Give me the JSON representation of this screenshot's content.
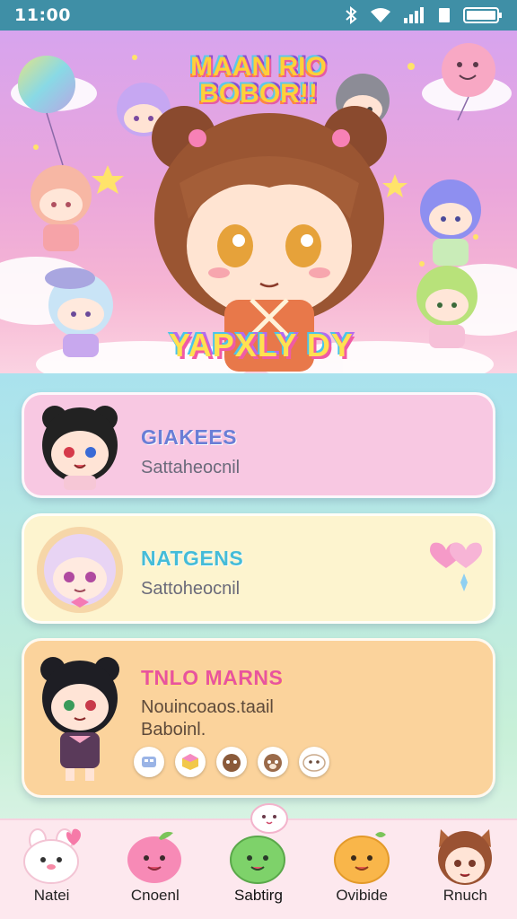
{
  "status_bar": {
    "time": "11:00",
    "icons": [
      "bluetooth-icon",
      "wifi-icon",
      "signal-icon",
      "battery-icon"
    ]
  },
  "hero": {
    "logo_top": "MAAN RIO BOBOR!!",
    "logo_bottom": "YAPXLY DY"
  },
  "cards": [
    {
      "title": "GIAKEES",
      "subtitle": "Sattaheocnil"
    },
    {
      "title": "NATGENS",
      "subtitle": "Sattoheocnil"
    },
    {
      "title": "TNLO MARNS",
      "subtitle": "Nouincoaos.taail Baboinl.",
      "chips": [
        "grid-chip",
        "cube-chip",
        "cat-chip",
        "dog-chip",
        "cloud-chip"
      ]
    }
  ],
  "nav": [
    {
      "label": "Natei",
      "icon": "bunny-icon"
    },
    {
      "label": "Cnoenl",
      "icon": "pink-mochi-icon"
    },
    {
      "label": "Sabtirg",
      "icon": "green-mochi-icon"
    },
    {
      "label": "Ovibide",
      "icon": "orange-mochi-icon"
    },
    {
      "label": "Rnuch",
      "icon": "fox-girl-icon"
    }
  ],
  "colors": {
    "status_bar": "#3f8fa6",
    "card_pink": "#f8c8e2",
    "card_yellow": "#fdf4cf",
    "card_orange": "#fbd39c",
    "nav_bg": "#fde8ee"
  }
}
